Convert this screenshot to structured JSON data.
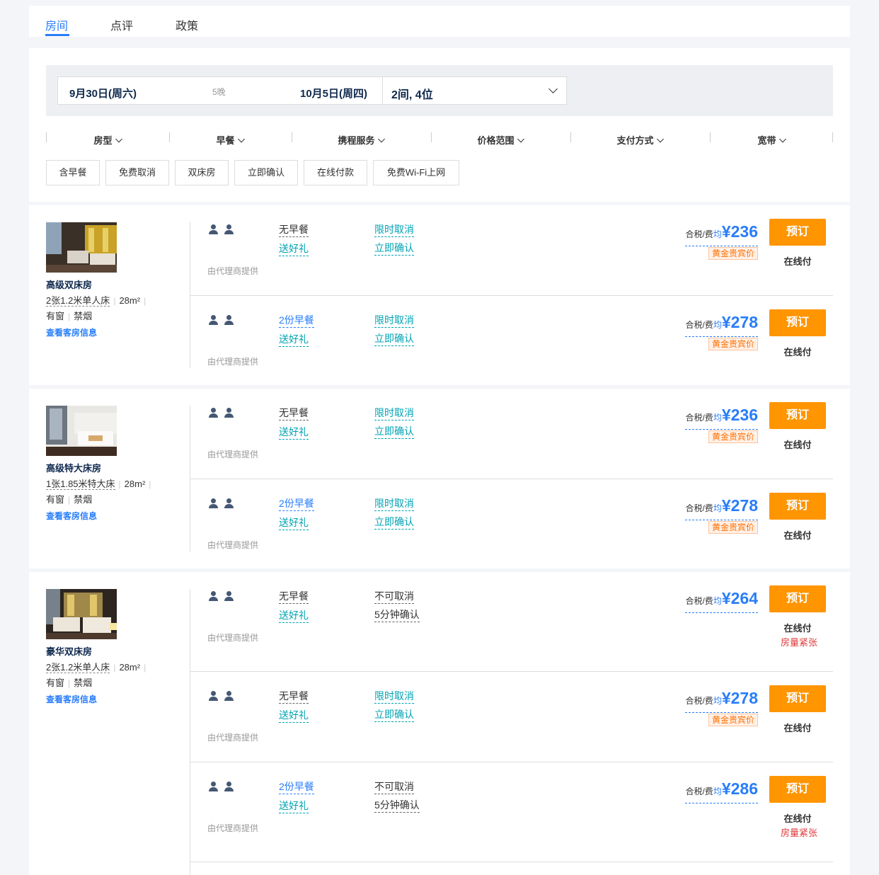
{
  "tabs": {
    "rooms": "房间",
    "reviews": "点评",
    "policy": "政策"
  },
  "search": {
    "checkin": "9月30日(周六)",
    "nights": "5晚",
    "checkout": "10月5日(周四)",
    "guests": "2间, 4位"
  },
  "filters": [
    "房型",
    "早餐",
    "携程服务",
    "价格范围",
    "支付方式",
    "宽带"
  ],
  "tags": [
    "含早餐",
    "免费取消",
    "双床房",
    "立即确认",
    "在线付款",
    "免费Wi-Fi上网"
  ],
  "rooms": [
    {
      "name": "高级双床房",
      "bed": "2张1.2米单人床",
      "area": "28m²",
      "window": "有窗",
      "smoking": "禁烟",
      "info_link": "查看客房信息",
      "offers": [
        {
          "breakfast": "无早餐",
          "gift": "送好礼",
          "cancel": "限时取消",
          "confirm": "立即确认",
          "provider": "由代理商提供",
          "price_label": "合税/费",
          "avg": "均",
          "price": "¥236",
          "badge": "黄金贵宾价",
          "book": "预订",
          "pay": "在线付",
          "note": ""
        },
        {
          "breakfast": "2份早餐",
          "gift": "送好礼",
          "cancel": "限时取消",
          "confirm": "立即确认",
          "provider": "由代理商提供",
          "price_label": "合税/费",
          "avg": "均",
          "price": "¥278",
          "badge": "黄金贵宾价",
          "book": "预订",
          "pay": "在线付",
          "note": ""
        }
      ]
    },
    {
      "name": "高级特大床房",
      "bed": "1张1.85米特大床",
      "area": "28m²",
      "window": "有窗",
      "smoking": "禁烟",
      "info_link": "查看客房信息",
      "offers": [
        {
          "breakfast": "无早餐",
          "gift": "送好礼",
          "cancel": "限时取消",
          "confirm": "立即确认",
          "provider": "由代理商提供",
          "price_label": "合税/费",
          "avg": "均",
          "price": "¥236",
          "badge": "黄金贵宾价",
          "book": "预订",
          "pay": "在线付",
          "note": ""
        },
        {
          "breakfast": "2份早餐",
          "gift": "送好礼",
          "cancel": "限时取消",
          "confirm": "立即确认",
          "provider": "由代理商提供",
          "price_label": "合税/费",
          "avg": "均",
          "price": "¥278",
          "badge": "黄金贵宾价",
          "book": "预订",
          "pay": "在线付",
          "note": ""
        }
      ]
    },
    {
      "name": "豪华双床房",
      "bed": "2张1.2米单人床",
      "area": "28m²",
      "window": "有窗",
      "smoking": "禁烟",
      "info_link": "查看客房信息",
      "offers": [
        {
          "breakfast": "无早餐",
          "gift": "送好礼",
          "cancel": "不可取消",
          "confirm": "5分钟确认",
          "provider": "由代理商提供",
          "price_label": "合税/费",
          "avg": "均",
          "price": "¥264",
          "badge": "",
          "book": "预订",
          "pay": "在线付",
          "note": "房量紧张"
        },
        {
          "breakfast": "无早餐",
          "gift": "送好礼",
          "cancel": "限时取消",
          "confirm": "立即确认",
          "provider": "由代理商提供",
          "price_label": "合税/费",
          "avg": "均",
          "price": "¥278",
          "badge": "黄金贵宾价",
          "book": "预订",
          "pay": "在线付",
          "note": ""
        },
        {
          "breakfast": "2份早餐",
          "gift": "送好礼",
          "cancel": "不可取消",
          "confirm": "5分钟确认",
          "provider": "由代理商提供",
          "price_label": "合税/费",
          "avg": "均",
          "price": "¥286",
          "badge": "",
          "book": "预订",
          "pay": "在线付",
          "note": "房量紧张"
        }
      ]
    }
  ]
}
